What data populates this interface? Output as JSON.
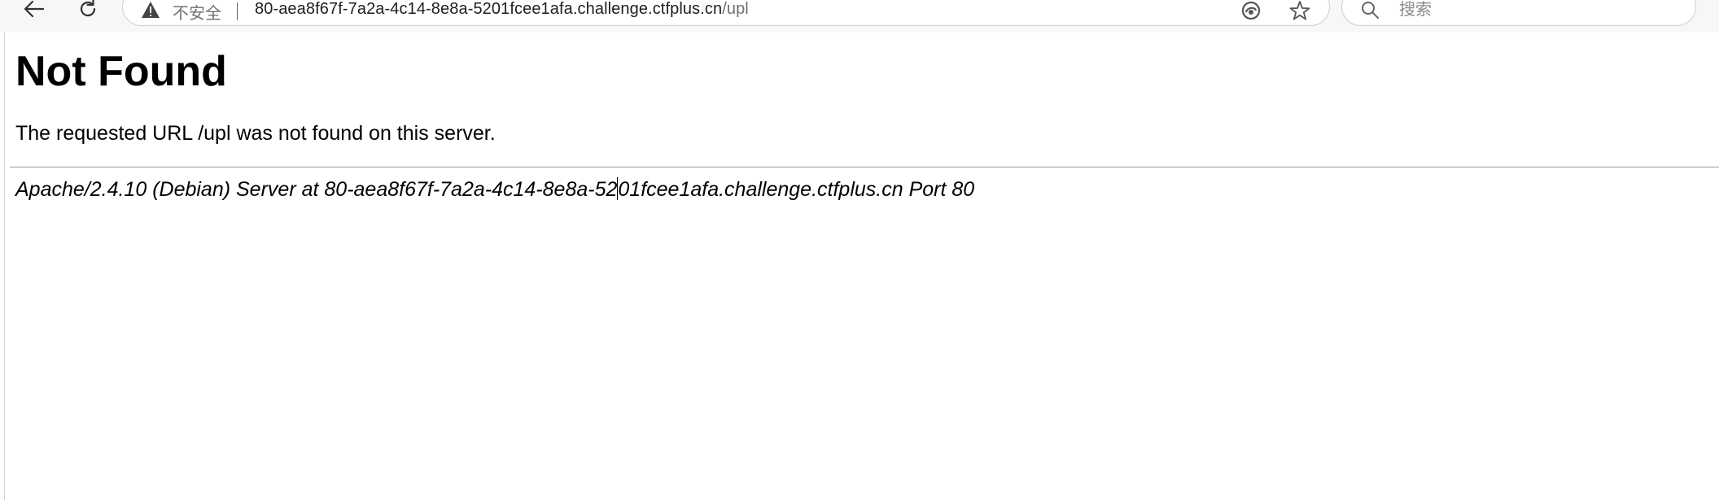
{
  "browser": {
    "security_label": "不安全",
    "url_host": "80-aea8f67f-7a2a-4c14-8e8a-5201fcee1afa.challenge.ctfplus.cn",
    "url_path": "/upl",
    "search_placeholder": "搜索"
  },
  "page": {
    "title": "Not Found",
    "message": "The requested URL /upl was not found on this server.",
    "server_signature_before_caret": "Apache/2.4.10 (Debian) Server at 80-aea8f67f-7a2a-4c14-8e8a-52",
    "server_signature_after_caret": "01fcee1afa.challenge.ctfplus.cn Port 80"
  },
  "icons": {
    "back": "back-arrow-icon",
    "reload": "reload-icon",
    "warning": "warning-triangle-icon",
    "edge": "edge-refresh-icon",
    "favorite": "star-icon",
    "search": "search-icon"
  }
}
